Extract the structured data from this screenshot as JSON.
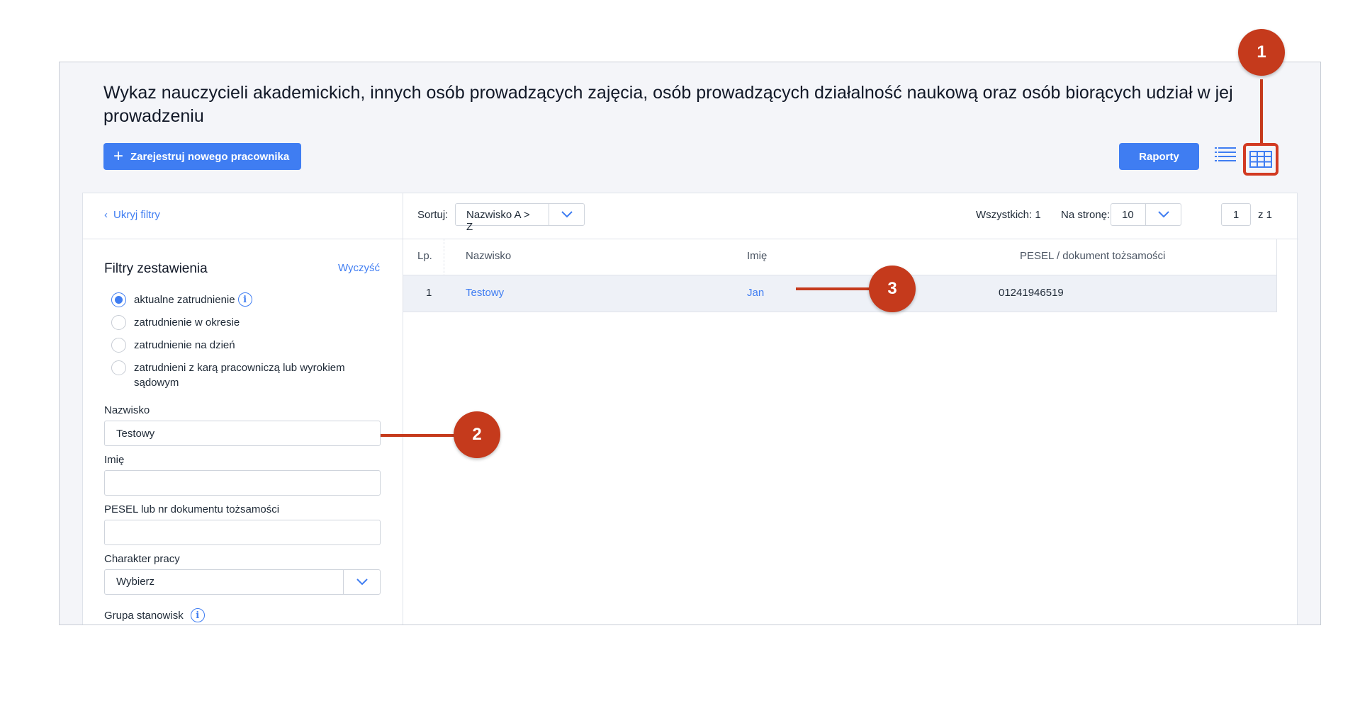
{
  "header": {
    "title": "Wykaz nauczycieli akademickich, innych osób prowadzących zajęcia, osób prowadzących działalność naukową oraz osób biorących udział w jej prowadzeniu",
    "register_button": "Zarejestruj nowego pracownika",
    "reports_button": "Raporty",
    "view_list_icon": "list-view-icon",
    "view_grid_icon": "table-view-icon"
  },
  "filters": {
    "hide_label": "Ukryj filtry",
    "title": "Filtry zestawienia",
    "clear_label": "Wyczyść",
    "radios": [
      {
        "label": "aktualne zatrudnienie",
        "checked": true
      },
      {
        "label": "zatrudnienie w okresie",
        "checked": false
      },
      {
        "label": "zatrudnienie na dzień",
        "checked": false
      },
      {
        "label": "zatrudnieni z karą pracowniczą lub wyrokiem sądowym",
        "checked": false
      }
    ],
    "surname_label": "Nazwisko",
    "surname_value": "Testowy",
    "name_label": "Imię",
    "name_value": "",
    "pesel_label": "PESEL lub nr dokumentu tożsamości",
    "pesel_value": "",
    "work_type_label": "Charakter pracy",
    "work_type_value": "Wybierz",
    "position_group_label": "Grupa stanowisk"
  },
  "toolbar": {
    "sort_label": "Sortuj:",
    "sort_value": "Nazwisko A > Z",
    "total_label": "Wszystkich: 1",
    "per_page_label": "Na stronę:",
    "per_page_value": "10",
    "page_value": "1",
    "page_of": "z  1"
  },
  "table": {
    "columns": [
      "Lp.",
      "Nazwisko",
      "Imię",
      "PESEL / dokument tożsamości"
    ],
    "rows": [
      {
        "lp": "1",
        "surname": "Testowy",
        "name": "Jan",
        "pesel": "01241946519"
      }
    ]
  },
  "callouts": [
    "1",
    "2",
    "3"
  ],
  "colors": {
    "accent": "#3f7df2",
    "callout": "#c53a1c"
  }
}
